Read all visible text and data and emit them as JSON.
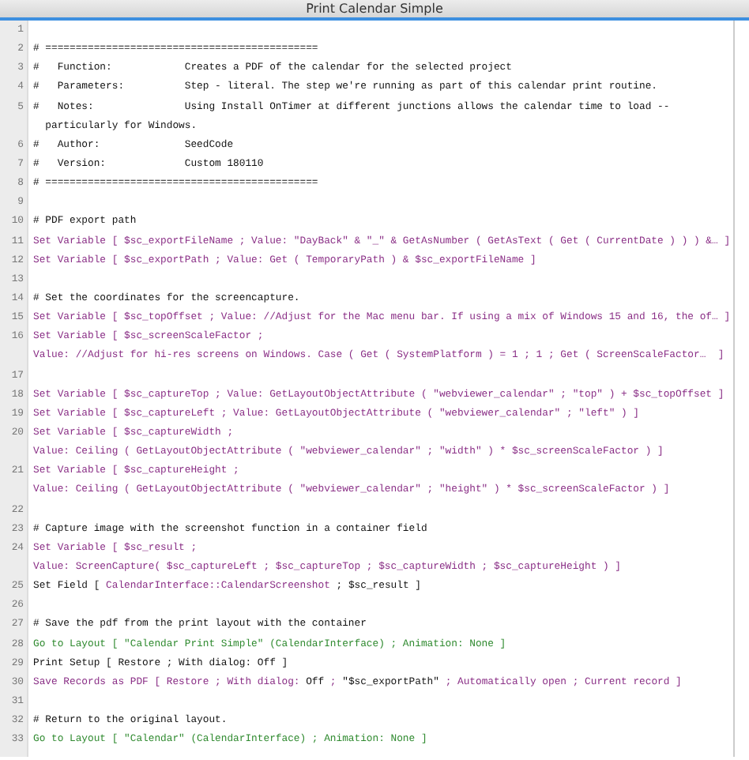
{
  "window": {
    "title": "Print Calendar Simple"
  },
  "lines": [
    {
      "number": "1"
    },
    {
      "number": "2",
      "segments": [
        {
          "kind": "plain",
          "text": "# ============================================="
        }
      ]
    },
    {
      "number": "3",
      "segments": [
        {
          "kind": "plain",
          "text": "#   Function:            Creates a PDF of the calendar for the selected project"
        }
      ]
    },
    {
      "number": "4",
      "segments": [
        {
          "kind": "plain",
          "text": "#   Parameters:          Step - literal. The step we're running as part of this calendar print routine."
        }
      ]
    },
    {
      "number": "5",
      "segments": [
        {
          "kind": "plain",
          "text": "#   Notes:               Using Install OnTimer at different junctions allows the calendar time to load --"
        }
      ],
      "continuation": [
        {
          "kind": "plain",
          "text": "  particularly for Windows."
        }
      ]
    },
    {
      "number": "6",
      "segments": [
        {
          "kind": "plain",
          "text": "#   Author:              SeedCode"
        }
      ]
    },
    {
      "number": "7",
      "segments": [
        {
          "kind": "plain",
          "text": "#   Version:             Custom 180110"
        }
      ]
    },
    {
      "number": "8",
      "segments": [
        {
          "kind": "plain",
          "text": "# ============================================="
        }
      ]
    },
    {
      "number": "9"
    },
    {
      "number": "10",
      "segments": [
        {
          "kind": "plain",
          "text": "# PDF export path"
        }
      ]
    },
    {
      "number": "11",
      "segments": [
        {
          "kind": "step",
          "text": "Set Variable [ $sc_exportFileName ; Value: \"DayBack\" & \"_\" & GetAsNumber ( GetAsText ( Get ( CurrentDate ) ) ) &… ]"
        }
      ]
    },
    {
      "number": "12",
      "segments": [
        {
          "kind": "step",
          "text": "Set Variable [ $sc_exportPath ; Value: Get ( TemporaryPath ) & $sc_exportFileName ]"
        }
      ]
    },
    {
      "number": "13"
    },
    {
      "number": "14",
      "segments": [
        {
          "kind": "plain",
          "text": "# Set the coordinates for the screencapture."
        }
      ]
    },
    {
      "number": "15",
      "segments": [
        {
          "kind": "step",
          "text": "Set Variable [ $sc_topOffset ; Value: //Adjust for the Mac menu bar. If using a mix of Windows 15 and 16, the of… ]"
        }
      ]
    },
    {
      "number": "16",
      "segments": [
        {
          "kind": "step",
          "text": "Set Variable [ $sc_screenScaleFactor ;"
        }
      ],
      "continuation": [
        {
          "kind": "step",
          "text": "Value: //Adjust for hi-res screens on Windows. Case ( Get ( SystemPlatform ) = 1 ; 1 ; Get ( ScreenScaleFactor…  ]"
        }
      ]
    },
    {
      "number": "17"
    },
    {
      "number": "18",
      "segments": [
        {
          "kind": "step",
          "text": "Set Variable [ $sc_captureTop ; Value: GetLayoutObjectAttribute ( \"webviewer_calendar\" ; \"top\" ) + $sc_topOffset ]"
        }
      ]
    },
    {
      "number": "19",
      "segments": [
        {
          "kind": "step",
          "text": "Set Variable [ $sc_captureLeft ; Value: GetLayoutObjectAttribute ( \"webviewer_calendar\" ; \"left\" ) ]"
        }
      ]
    },
    {
      "number": "20",
      "segments": [
        {
          "kind": "step",
          "text": "Set Variable [ $sc_captureWidth ;"
        }
      ],
      "continuation": [
        {
          "kind": "step",
          "text": "Value: Ceiling ( GetLayoutObjectAttribute ( \"webviewer_calendar\" ; \"width\" ) * $sc_screenScaleFactor ) ]"
        }
      ]
    },
    {
      "number": "21",
      "segments": [
        {
          "kind": "step",
          "text": "Set Variable [ $sc_captureHeight ;"
        }
      ],
      "continuation": [
        {
          "kind": "step",
          "text": "Value: Ceiling ( GetLayoutObjectAttribute ( \"webviewer_calendar\" ; \"height\" ) * $sc_screenScaleFactor ) ]"
        }
      ]
    },
    {
      "number": "22"
    },
    {
      "number": "23",
      "segments": [
        {
          "kind": "plain",
          "text": "# Capture image with the screenshot function in a container field"
        }
      ]
    },
    {
      "number": "24",
      "segments": [
        {
          "kind": "step",
          "text": "Set Variable [ $sc_result ;"
        }
      ],
      "continuation": [
        {
          "kind": "step",
          "text": "Value: ScreenCapture( $sc_captureLeft ; $sc_captureTop ; $sc_captureWidth ; $sc_captureHeight ) ]"
        }
      ]
    },
    {
      "number": "25",
      "segments": [
        {
          "kind": "plain",
          "text": "Set Field [ "
        },
        {
          "kind": "step",
          "text": "CalendarInterface::CalendarScreenshot"
        },
        {
          "kind": "plain",
          "text": " ; $sc_result ]"
        }
      ]
    },
    {
      "number": "26"
    },
    {
      "number": "27",
      "segments": [
        {
          "kind": "plain",
          "text": "# Save the pdf from the print layout with the container"
        }
      ]
    },
    {
      "number": "28",
      "segments": [
        {
          "kind": "layout",
          "text": "Go to Layout [ \"Calendar Print Simple\" (CalendarInterface) ; Animation: None ]"
        }
      ]
    },
    {
      "number": "29",
      "segments": [
        {
          "kind": "plain",
          "text": "Print Setup [ Restore ; With dialog: Off ]"
        }
      ]
    },
    {
      "number": "30",
      "segments": [
        {
          "kind": "step",
          "text": "Save Records as PDF [ Restore ; With dialog: "
        },
        {
          "kind": "plain",
          "text": "Off"
        },
        {
          "kind": "step",
          "text": " ; "
        },
        {
          "kind": "plain",
          "text": "\"$sc_exportPath\""
        },
        {
          "kind": "step",
          "text": " ; Automatically open ; Current record ]"
        }
      ]
    },
    {
      "number": "31"
    },
    {
      "number": "32",
      "segments": [
        {
          "kind": "plain",
          "text": "# Return to the original layout."
        }
      ]
    },
    {
      "number": "33",
      "segments": [
        {
          "kind": "layout",
          "text": "Go to Layout [ \"Calendar\" (CalendarInterface) ; Animation: None ]"
        }
      ]
    }
  ]
}
